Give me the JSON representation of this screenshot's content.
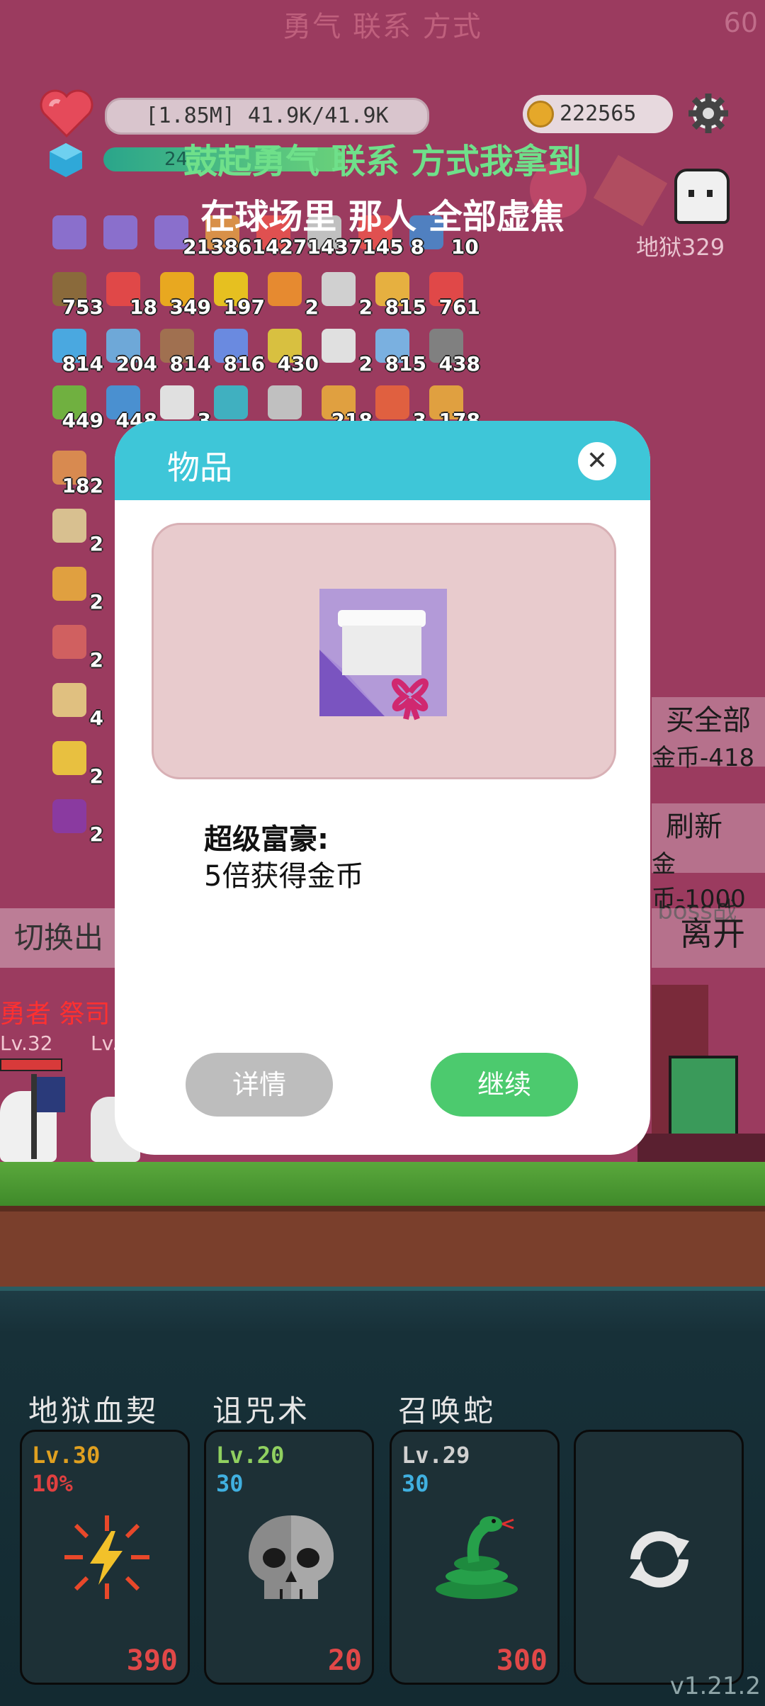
{
  "top_title": "勇气 联系 方式",
  "fps": "60",
  "status": {
    "hp_text": "[1.85M] 41.9K/41.9K",
    "coins": "222565",
    "xp_text": "24"
  },
  "lyrics": {
    "line1": "鼓起勇气 联系 方式我拿到",
    "line2": "在球场里 那人 全部虚焦"
  },
  "hell_label": "地狱329",
  "inventory_row1_counts": [
    "2138",
    "6142",
    "7143",
    "7145",
    "8",
    "10"
  ],
  "inventory": [
    {
      "count": "753",
      "color": "#8a6a3b"
    },
    {
      "count": "18",
      "color": "#e04848"
    },
    {
      "count": "349",
      "color": "#e8a820"
    },
    {
      "count": "197",
      "color": "#e6c020"
    },
    {
      "count": "2",
      "color": "#e68a30"
    },
    {
      "count": "2",
      "color": "#d0d0d0"
    },
    {
      "count": "815",
      "color": "#e6b040"
    },
    {
      "count": "761",
      "color": "#e04848"
    },
    {
      "count": "814",
      "color": "#4aa8e0"
    },
    {
      "count": "204",
      "color": "#6ea8d8"
    },
    {
      "count": "814",
      "color": "#a07050"
    },
    {
      "count": "816",
      "color": "#6a8ae0"
    },
    {
      "count": "430",
      "color": "#d8c040"
    },
    {
      "count": "2",
      "color": "#e0e0e0"
    },
    {
      "count": "815",
      "color": "#7ab0e0"
    },
    {
      "count": "438",
      "color": "#808080"
    },
    {
      "count": "449",
      "color": "#70b040"
    },
    {
      "count": "448",
      "color": "#4a90d0"
    },
    {
      "count": "3",
      "color": "#e0e0e0"
    },
    {
      "count": "",
      "color": "#40b0c0"
    },
    {
      "count": "",
      "color": "#c0c0c0"
    },
    {
      "count": "218",
      "color": "#e0a040"
    },
    {
      "count": "3",
      "color": "#e06040"
    },
    {
      "count": "178",
      "color": "#e0a040"
    }
  ],
  "left_column_counts": [
    "182",
    "2",
    "2",
    "2",
    "4",
    "2",
    "2"
  ],
  "side_buttons": {
    "buy_all": "买全部",
    "buy_all_cost": "金币-418",
    "refresh": "刷新",
    "refresh_cost": "金币-1000",
    "boss": "boss战",
    "leave": "离开"
  },
  "switch_label": "切换出",
  "red_names": "勇者 祭司",
  "lv_left": "Lv.32",
  "lv_mid": "Lv.",
  "modal": {
    "title": "物品",
    "close_icon": "close-icon",
    "item_name": "超级富豪:",
    "item_desc": "5倍获得金币",
    "detail_label": "详情",
    "continue_label": "继续",
    "preview_icon": "gift-card-icon"
  },
  "skills": [
    {
      "name": "地狱血契",
      "level": "Lv.30",
      "value": "10%",
      "cost": "390",
      "level_color": "#e0a020",
      "value_color": "#e04040",
      "icon": "lightning-burst-icon"
    },
    {
      "name": "诅咒术",
      "level": "Lv.20",
      "value": "30",
      "cost": "20",
      "level_color": "#90d060",
      "value_color": "#40b0e0",
      "icon": "skull-icon"
    },
    {
      "name": "召唤蛇",
      "level": "Lv.29",
      "value": "30",
      "cost": "300",
      "level_color": "#d0d0d0",
      "value_color": "#40b0e0",
      "icon": "snake-icon"
    }
  ],
  "refresh_card_icon": "refresh-icon",
  "version": "v1.21.2"
}
